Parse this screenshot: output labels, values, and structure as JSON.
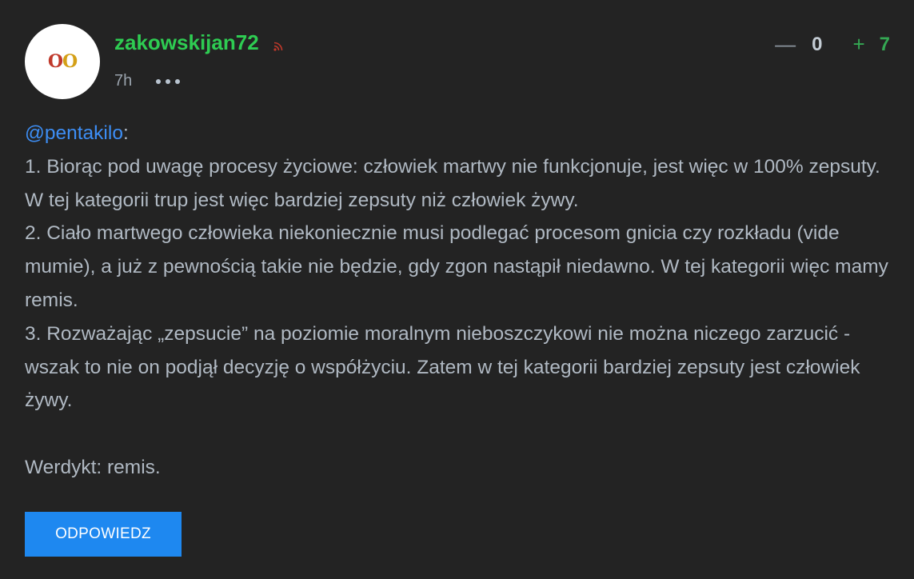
{
  "author": {
    "username": "zakowskijan72",
    "avatar_text_1": "O",
    "avatar_text_2": "O",
    "time": "7h"
  },
  "icons": {
    "rss": "rss-icon",
    "more": "more-options-icon"
  },
  "votes": {
    "minus_symbol": "—",
    "minus_count": "0",
    "plus_symbol": "+",
    "plus_count": "7"
  },
  "comment": {
    "mention": "@pentakilo",
    "mention_suffix": ":",
    "line1": "1. Biorąc pod uwagę procesy życiowe: człowiek martwy nie funkcjonuje, jest więc w 100% zepsuty. W tej kategorii trup jest więc bardziej zepsuty niż człowiek żywy.",
    "line2": "2. Ciało martwego człowieka niekoniecznie musi podlegać procesom gnicia czy rozkładu (vide mumie), a już z pewnością takie nie będzie, gdy zgon nastąpił niedawno. W tej kategorii więc mamy remis.",
    "line3": "3. Rozważając „zepsucie” na poziomie moralnym nieboszczykowi nie można niczego zarzucić - wszak to nie on podjął decyzję o współżyciu. Zatem w tej kategorii bardziej zepsuty jest człowiek żywy.",
    "verdict": "Werdykt: remis."
  },
  "actions": {
    "reply_label": "ODPOWIEDZ"
  },
  "colors": {
    "background": "#232323",
    "username": "#2ecc52",
    "mention": "#3d8ef5",
    "body_text": "#b0b9c3",
    "plus": "#34a853",
    "reply_button": "#1e88f0"
  }
}
